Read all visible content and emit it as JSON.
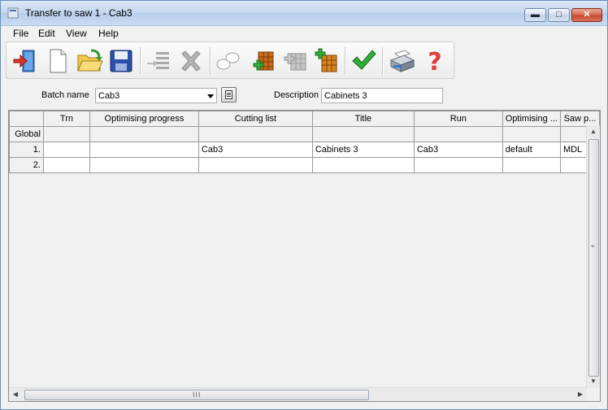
{
  "window": {
    "title": "Transfer to saw 1 - Cab3"
  },
  "menu": {
    "items": [
      "File",
      "Edit",
      "View",
      "Help"
    ]
  },
  "toolbar": {
    "buttons": [
      "exit",
      "new",
      "open",
      "save",
      "insert-line",
      "delete",
      "link",
      "add-parts",
      "edit-parts",
      "add-board",
      "accept",
      "print",
      "help"
    ]
  },
  "batch": {
    "name_label": "Batch name",
    "name_value": "Cab3",
    "description_label": "Description",
    "description_value": "Cabinets 3"
  },
  "grid": {
    "columns": [
      "",
      "Trn",
      "Optimising progress",
      "Cutting list",
      "Title",
      "Run",
      "Optimising ...",
      "Saw p..."
    ],
    "rows": [
      {
        "header": "Global",
        "cells": [
          "",
          "",
          "",
          "",
          "",
          "",
          ""
        ]
      },
      {
        "header": "1.",
        "cells": [
          "",
          "",
          "Cab3",
          "Cabinets 3",
          "Cab3",
          "default",
          "MDL"
        ]
      },
      {
        "header": "2.",
        "cells": [
          "",
          "",
          "",
          "",
          "",
          "",
          ""
        ]
      }
    ]
  },
  "scrollbars": {
    "h_grip": "III"
  }
}
